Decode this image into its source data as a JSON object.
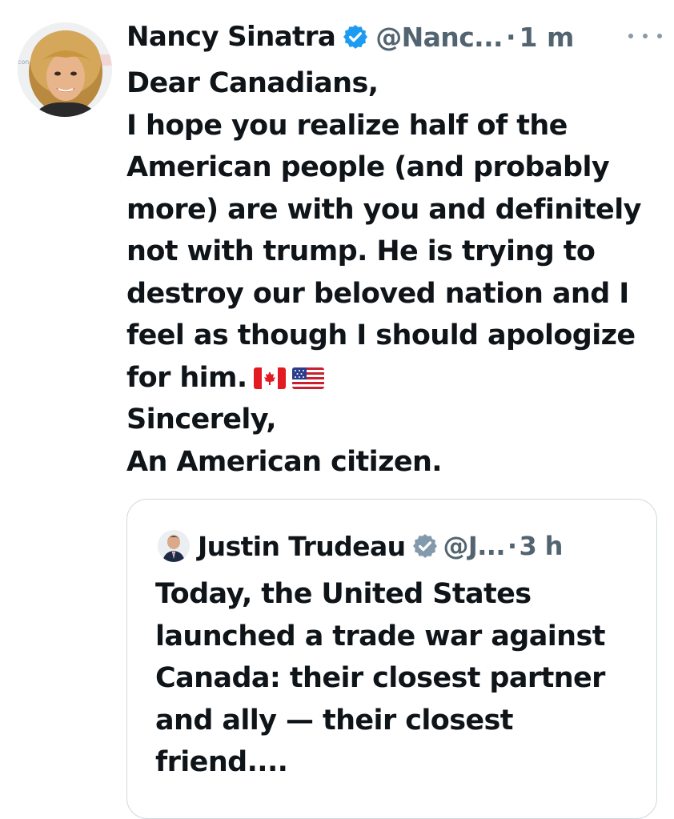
{
  "tweet": {
    "author_name": "Nancy Sinatra",
    "author_handle": "@Nanc...",
    "separator": "·",
    "time": "1 m",
    "more_icon": "more-horizontal-icon",
    "verified_color": "#1d9bf0",
    "lines": [
      "Dear Canadians,",
      "I hope you realize half of the",
      "American people (and probably",
      "more) are with you and definitely",
      "not with trump. He is trying to",
      "destroy our beloved nation and I",
      "feel as though I should apologize",
      "for him.",
      "Sincerely,",
      "An American citizen."
    ],
    "flags": [
      "canada-flag-icon",
      "us-flag-icon"
    ]
  },
  "quote": {
    "author_name": "Justin Trudeau",
    "author_handle": "@J...",
    "separator": "·",
    "time": "3 h",
    "verified_color": "#829aab",
    "lines": [
      "Today, the United States",
      "launched a trade war against",
      "Canada: their closest partner",
      "and ally — their closest",
      "friend...."
    ]
  },
  "colors": {
    "text": "#0f1419",
    "secondary": "#536471",
    "border": "#cfd9de"
  }
}
